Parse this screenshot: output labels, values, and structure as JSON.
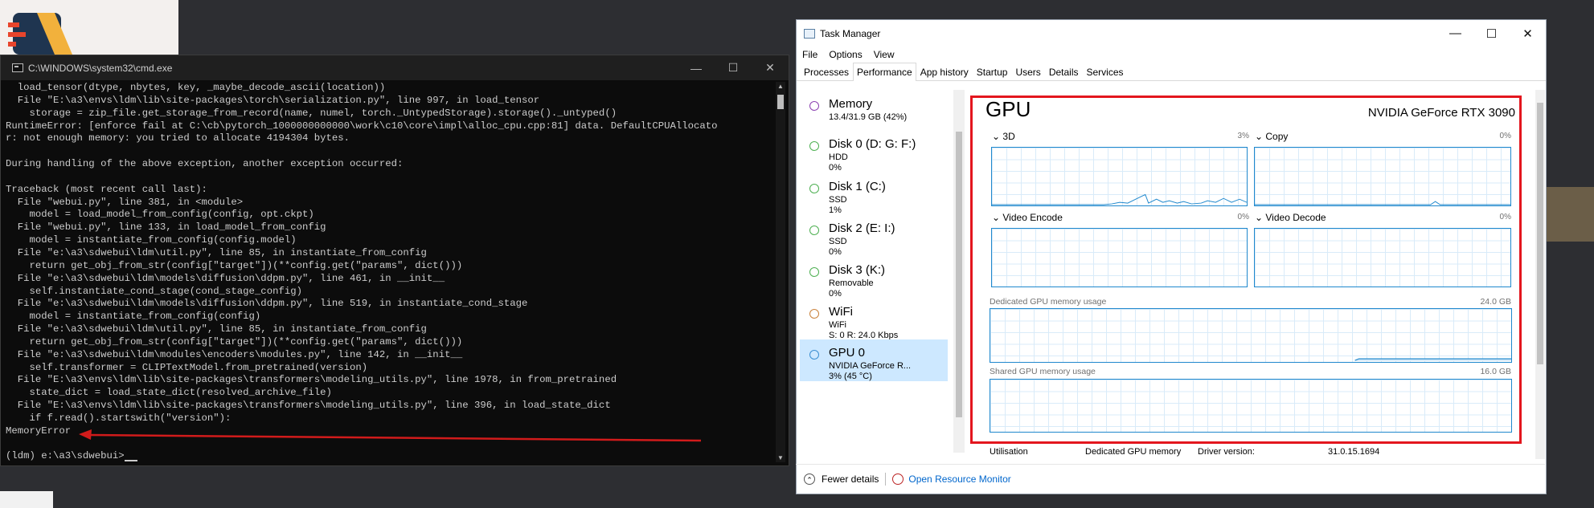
{
  "cmd": {
    "title": "C:\\WINDOWS\\system32\\cmd.exe",
    "lines": [
      "  load_tensor(dtype, nbytes, key, _maybe_decode_ascii(location))",
      "  File \"E:\\a3\\envs\\ldm\\lib\\site-packages\\torch\\serialization.py\", line 997, in load_tensor",
      "    storage = zip_file.get_storage_from_record(name, numel, torch._UntypedStorage).storage()._untyped()",
      "RuntimeError: [enforce fail at C:\\cb\\pytorch_1000000000000\\work\\c10\\core\\impl\\alloc_cpu.cpp:81] data. DefaultCPUAllocato",
      "r: not enough memory: you tried to allocate 4194304 bytes.",
      "",
      "During handling of the above exception, another exception occurred:",
      "",
      "Traceback (most recent call last):",
      "  File \"webui.py\", line 381, in <module>",
      "    model = load_model_from_config(config, opt.ckpt)",
      "  File \"webui.py\", line 133, in load_model_from_config",
      "    model = instantiate_from_config(config.model)",
      "  File \"e:\\a3\\sdwebui\\ldm\\util.py\", line 85, in instantiate_from_config",
      "    return get_obj_from_str(config[\"target\"])(**config.get(\"params\", dict()))",
      "  File \"e:\\a3\\sdwebui\\ldm\\models\\diffusion\\ddpm.py\", line 461, in __init__",
      "    self.instantiate_cond_stage(cond_stage_config)",
      "  File \"e:\\a3\\sdwebui\\ldm\\models\\diffusion\\ddpm.py\", line 519, in instantiate_cond_stage",
      "    model = instantiate_from_config(config)",
      "  File \"e:\\a3\\sdwebui\\ldm\\util.py\", line 85, in instantiate_from_config",
      "    return get_obj_from_str(config[\"target\"])(**config.get(\"params\", dict()))",
      "  File \"e:\\a3\\sdwebui\\ldm\\modules\\encoders\\modules.py\", line 142, in __init__",
      "    self.transformer = CLIPTextModel.from_pretrained(version)",
      "  File \"E:\\a3\\envs\\ldm\\lib\\site-packages\\transformers\\modeling_utils.py\", line 1978, in from_pretrained",
      "    state_dict = load_state_dict(resolved_archive_file)",
      "  File \"E:\\a3\\envs\\ldm\\lib\\site-packages\\transformers\\modeling_utils.py\", line 396, in load_state_dict",
      "    if f.read().startswith(\"version\"):",
      "MemoryError",
      "",
      "(ldm) e:\\a3\\sdwebui>"
    ],
    "annotation_color": "#d11b1b"
  },
  "tm": {
    "title": "Task Manager",
    "menu": [
      "File",
      "Options",
      "View"
    ],
    "tabs": [
      "Processes",
      "Performance",
      "App history",
      "Startup",
      "Users",
      "Details",
      "Services"
    ],
    "active_tab": 1,
    "resources": [
      {
        "name": "Memory",
        "sub1": "13.4/31.9 GB (42%)",
        "sub2": "",
        "sub3": "",
        "color": "#8b3fb0"
      },
      {
        "name": "Disk 0 (D: G: F:)",
        "sub1": "HDD",
        "sub2": "0%",
        "sub3": "",
        "color": "#4caf50"
      },
      {
        "name": "Disk 1 (C:)",
        "sub1": "SSD",
        "sub2": "1%",
        "sub3": "",
        "color": "#4caf50"
      },
      {
        "name": "Disk 2 (E: I:)",
        "sub1": "SSD",
        "sub2": "0%",
        "sub3": "",
        "color": "#4caf50"
      },
      {
        "name": "Disk 3 (K:)",
        "sub1": "Removable",
        "sub2": "0%",
        "sub3": "",
        "color": "#4caf50"
      },
      {
        "name": "WiFi",
        "sub1": "WiFi",
        "sub2": "S: 0 R: 24.0 Kbps",
        "sub3": "",
        "color": "#c9813a"
      },
      {
        "name": "GPU 0",
        "sub1": "NVIDIA GeForce R...",
        "sub2": "3% (45 °C)",
        "sub3": "",
        "color": "#3a8ed1"
      }
    ],
    "gpu": {
      "title": "GPU",
      "model": "NVIDIA GeForce RTX 3090",
      "engines": [
        {
          "label": "3D",
          "pct": "3%"
        },
        {
          "label": "Copy",
          "pct": "0%"
        },
        {
          "label": "Video Encode",
          "pct": "0%"
        },
        {
          "label": "Video Decode",
          "pct": "0%"
        }
      ],
      "dedicated_label": "Dedicated GPU memory usage",
      "dedicated_max": "24.0 GB",
      "shared_label": "Shared GPU memory usage",
      "shared_max": "16.0 GB",
      "bottom": {
        "utilisation": "Utilisation",
        "dedicated_mem": "Dedicated GPU memory",
        "driver_label": "Driver version:",
        "driver_value": "31.0.15.1694"
      }
    },
    "footer": {
      "fewer": "Fewer details",
      "monitor": "Open Resource Monitor"
    }
  }
}
